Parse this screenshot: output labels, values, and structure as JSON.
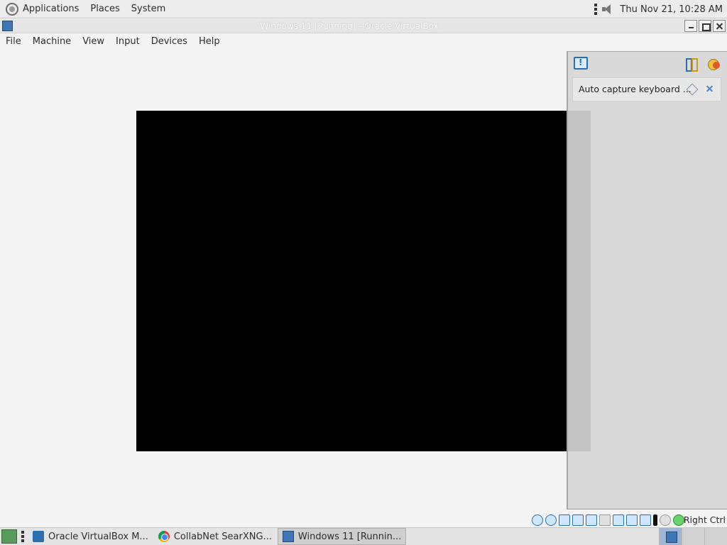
{
  "top_panel": {
    "menus": [
      "Applications",
      "Places",
      "System"
    ],
    "clock": "Thu Nov 21, 10:28 AM"
  },
  "window": {
    "title": "Windows 11 [Running] - Oracle VirtualBox"
  },
  "menubar": {
    "items": [
      "File",
      "Machine",
      "View",
      "Input",
      "Devices",
      "Help"
    ]
  },
  "notification_center": {
    "notification_text": "Auto capture keyboard ..."
  },
  "statusbar": {
    "host_key": "Right Ctrl"
  },
  "taskbar": {
    "tasks": [
      {
        "label": "Oracle VirtualBox M...",
        "icon": "virtualbox-icon"
      },
      {
        "label": "CollabNet SearXNG...",
        "icon": "chrome-icon"
      },
      {
        "label": "Windows 11 [Runnin...",
        "icon": "vm-window-icon"
      }
    ]
  },
  "colors": {
    "vm_screen": "#000000",
    "accent": "#2b6fb3"
  }
}
